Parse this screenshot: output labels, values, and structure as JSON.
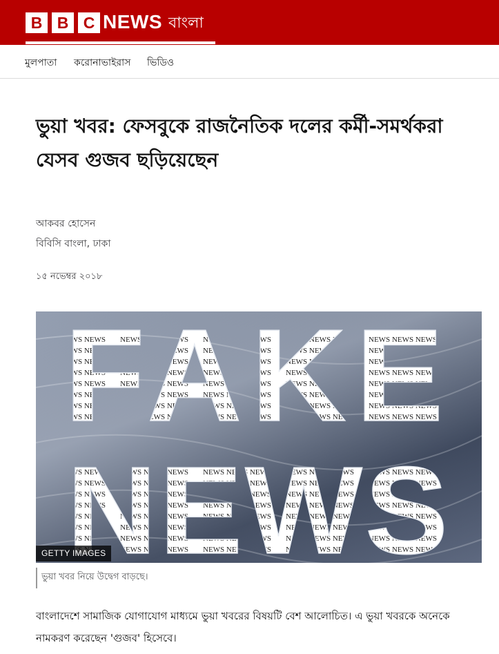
{
  "header": {
    "brand_letters": [
      "B",
      "B",
      "C"
    ],
    "news_label": "NEWS",
    "language_label": "বাংলা",
    "brand_color": "#b80000"
  },
  "nav": {
    "items": [
      {
        "label": "মুলপাতা"
      },
      {
        "label": "করোনাভাইরাস"
      },
      {
        "label": "ভিডিও"
      }
    ]
  },
  "article": {
    "headline": "ভুয়া খবর: ফেসবুকে রাজনৈতিক দলের কর্মী-সমর্থকরা যেসব গুজব ছড়িয়েছেন",
    "author": "আকবর হোসেন",
    "organization": "বিবিসি বাংলা, ঢাকা",
    "date": "১৫ নভেম্বর ২০১৮",
    "image": {
      "credit": "GETTY IMAGES",
      "caption": "ভুয়া খবর নিয়ে উদ্বেগ বাড়ছে।",
      "overlay_words": [
        "FAKE",
        "NEWS"
      ],
      "pattern_text": "NEWS NEWS NEWS NEWS NEWS NEWS NEWS NEWS"
    },
    "paragraph": "বাংলাদেশে সামাজিক যোগাযোগ মাধ্যমে ভুয়া খবরের বিষয়টি বেশ আলোচিত। এ ভুয়া খবরকে অনেকে নামকরণ করেছেন 'গুজব' হিসেবে।"
  }
}
